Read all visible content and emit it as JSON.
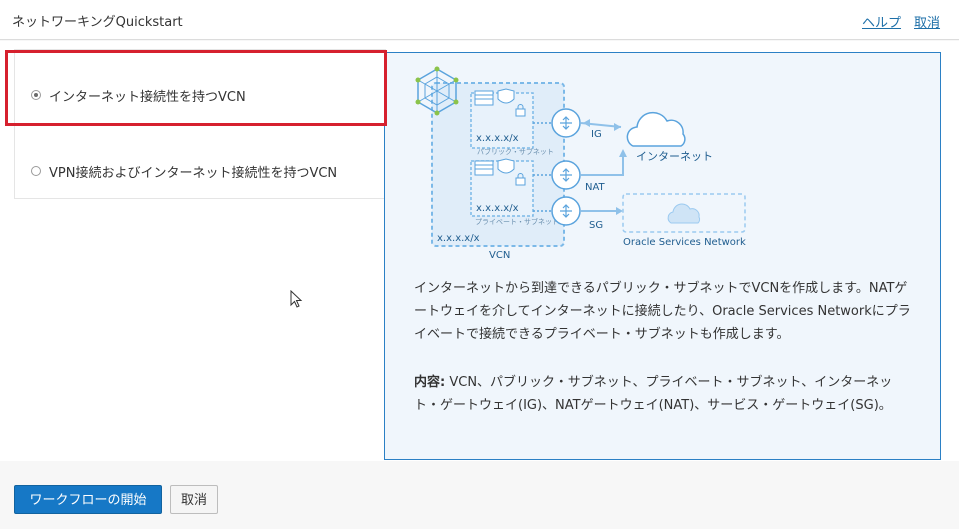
{
  "header": {
    "title": "ネットワーキングQuickstart",
    "help_link": "ヘルプ",
    "cancel_link": "取消"
  },
  "options": [
    {
      "label": "インターネット接続性を持つVCN",
      "selected": true
    },
    {
      "label": "VPN接続およびインターネット接続性を持つVCN",
      "selected": false
    }
  ],
  "diagram": {
    "subnet_cidr_1": "x.x.x.x/x",
    "subnet_cidr_2": "x.x.x.x/x",
    "vcn_cidr": "x.x.x.x/x",
    "public_subnet_label": "パブリック・サブネット",
    "private_subnet_label": "プライベート・サブネット",
    "vcn_label": "VCN",
    "ig_label": "IG",
    "nat_label": "NAT",
    "sg_label": "SG",
    "internet_label": "インターネット",
    "osn_label": "Oracle Services Network"
  },
  "description": "インターネットから到達できるパブリック・サブネットでVCNを作成します。NATゲートウェイを介してインターネットに接続したり、Oracle Services Networkにプライベートで接続できるプライベート・サブネットも作成します。",
  "contents": {
    "label": "内容:",
    "text": "VCN、パブリック・サブネット、プライベート・サブネット、インターネット・ゲートウェイ(IG)、NATゲートウェイ(NAT)、サービス・ゲートウェイ(SG)。"
  },
  "footer": {
    "start_button": "ワークフローの開始",
    "cancel_button": "取消"
  },
  "colors": {
    "accent": "#1678c6",
    "highlight": "#d6202e",
    "diagram_blue": "#7cb9e8"
  }
}
